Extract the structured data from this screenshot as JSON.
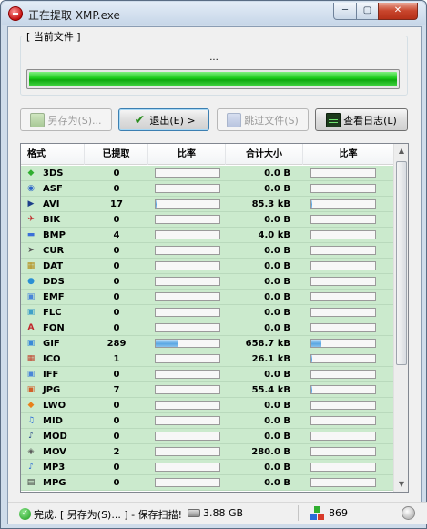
{
  "window": {
    "title": "正在提取 XMP.exe",
    "min_label": "─",
    "max_label": "▢",
    "close_label": "✕"
  },
  "current": {
    "group_label": "[ 当前文件 ]",
    "file": "...",
    "progress": 1.0
  },
  "toolbar": {
    "save_label": "另存为(S)...",
    "exit_label": "退出(E) >",
    "skip_label": "跳过文件(S)",
    "log_label": "查看日志(L)"
  },
  "table": {
    "headers": [
      "格式",
      "已提取",
      "比率",
      "合计大小",
      "比率"
    ],
    "rows": [
      {
        "fmt": "3DS",
        "count": "0",
        "ratio1": 0,
        "size": "0.0 B",
        "ratio2": 0,
        "icon": "3ds-file-icon",
        "glyph": "◆",
        "color": "#2fae2f"
      },
      {
        "fmt": "ASF",
        "count": "0",
        "ratio1": 0,
        "size": "0.0 B",
        "ratio2": 0,
        "icon": "asf-file-icon",
        "glyph": "◉",
        "color": "#2b65c9"
      },
      {
        "fmt": "AVI",
        "count": "17",
        "ratio1": 0.02,
        "size": "85.3 kB",
        "ratio2": 0.02,
        "icon": "avi-file-icon",
        "glyph": "▶",
        "color": "#1d3f8a"
      },
      {
        "fmt": "BIK",
        "count": "0",
        "ratio1": 0,
        "size": "0.0 B",
        "ratio2": 0,
        "icon": "bik-file-icon",
        "glyph": "✈",
        "color": "#c02a2a"
      },
      {
        "fmt": "BMP",
        "count": "4",
        "ratio1": 0,
        "size": "4.0 kB",
        "ratio2": 0,
        "icon": "bmp-file-icon",
        "glyph": "▬",
        "color": "#3a6fd8"
      },
      {
        "fmt": "CUR",
        "count": "0",
        "ratio1": 0,
        "size": "0.0 B",
        "ratio2": 0,
        "icon": "cursor-file-icon",
        "glyph": "➤",
        "color": "#555555"
      },
      {
        "fmt": "DAT",
        "count": "0",
        "ratio1": 0,
        "size": "0.0 B",
        "ratio2": 0,
        "icon": "dat-file-icon",
        "glyph": "▦",
        "color": "#b38a12"
      },
      {
        "fmt": "DDS",
        "count": "0",
        "ratio1": 0,
        "size": "0.0 B",
        "ratio2": 0,
        "icon": "dds-file-icon",
        "glyph": "●",
        "color": "#2a8fd4"
      },
      {
        "fmt": "EMF",
        "count": "0",
        "ratio1": 0,
        "size": "0.0 B",
        "ratio2": 0,
        "icon": "emf-file-icon",
        "glyph": "▣",
        "color": "#4a86d8"
      },
      {
        "fmt": "FLC",
        "count": "0",
        "ratio1": 0,
        "size": "0.0 B",
        "ratio2": 0,
        "icon": "flc-file-icon",
        "glyph": "▣",
        "color": "#3fa0c8"
      },
      {
        "fmt": "FON",
        "count": "0",
        "ratio1": 0,
        "size": "0.0 B",
        "ratio2": 0,
        "icon": "font-file-icon",
        "glyph": "A",
        "color": "#c0262b"
      },
      {
        "fmt": "GIF",
        "count": "289",
        "ratio1": 0.35,
        "size": "658.7 kB",
        "ratio2": 0.15,
        "icon": "gif-file-icon",
        "glyph": "▣",
        "color": "#3a8ad8"
      },
      {
        "fmt": "ICO",
        "count": "1",
        "ratio1": 0,
        "size": "26.1 kB",
        "ratio2": 0.01,
        "icon": "ico-file-icon",
        "glyph": "▦",
        "color": "#c0402a"
      },
      {
        "fmt": "IFF",
        "count": "0",
        "ratio1": 0,
        "size": "0.0 B",
        "ratio2": 0,
        "icon": "iff-file-icon",
        "glyph": "▣",
        "color": "#4a86d8"
      },
      {
        "fmt": "JPG",
        "count": "7",
        "ratio1": 0,
        "size": "55.4 kB",
        "ratio2": 0.01,
        "icon": "jpg-file-icon",
        "glyph": "▣",
        "color": "#d2602a"
      },
      {
        "fmt": "LWO",
        "count": "0",
        "ratio1": 0,
        "size": "0.0 B",
        "ratio2": 0,
        "icon": "lwo-file-icon",
        "glyph": "◆",
        "color": "#e8801a"
      },
      {
        "fmt": "MID",
        "count": "0",
        "ratio1": 0,
        "size": "0.0 B",
        "ratio2": 0,
        "icon": "midi-file-icon",
        "glyph": "♫",
        "color": "#2a6ad8"
      },
      {
        "fmt": "MOD",
        "count": "0",
        "ratio1": 0,
        "size": "0.0 B",
        "ratio2": 0,
        "icon": "mod-file-icon",
        "glyph": "♪",
        "color": "#2a4a8a"
      },
      {
        "fmt": "MOV",
        "count": "2",
        "ratio1": 0,
        "size": "280.0 B",
        "ratio2": 0,
        "icon": "mov-file-icon",
        "glyph": "◈",
        "color": "#5a5a5a"
      },
      {
        "fmt": "MP3",
        "count": "0",
        "ratio1": 0,
        "size": "0.0 B",
        "ratio2": 0,
        "icon": "mp3-file-icon",
        "glyph": "♪",
        "color": "#2a6ad8"
      },
      {
        "fmt": "MPG",
        "count": "0",
        "ratio1": 0,
        "size": "0.0 B",
        "ratio2": 0,
        "icon": "mpg-file-icon",
        "glyph": "▤",
        "color": "#333333"
      }
    ]
  },
  "status": {
    "text": "完成. [ 另存为(S)... ] - 保存扫描!",
    "disk": "3.88 GB",
    "count": "869"
  }
}
